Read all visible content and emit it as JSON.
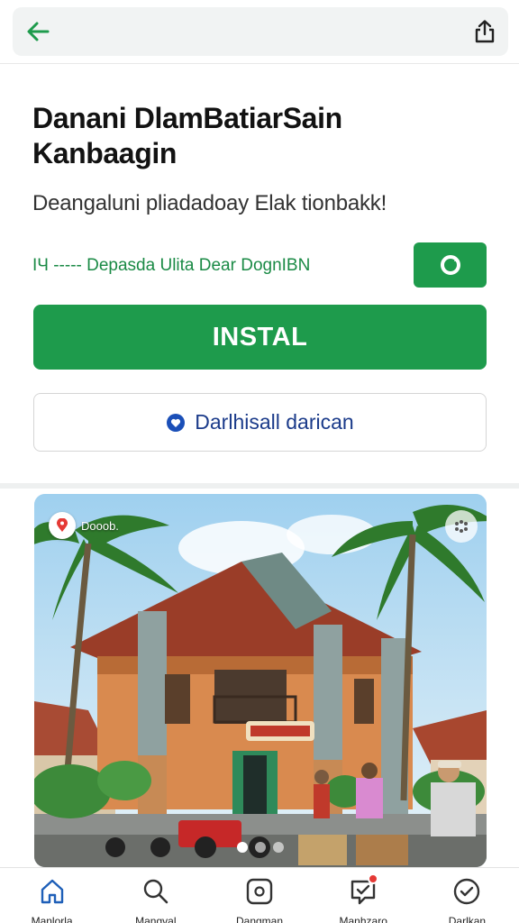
{
  "header": {
    "back_icon": "arrow-left-icon",
    "share_icon": "share-icon",
    "accent_color": "#1e9b4c"
  },
  "app": {
    "title": "Danani DlamBatiarSain Kanbaagin",
    "subtitle": "Deangaluni pliadadoay Elak tionbakk!"
  },
  "developer_link": {
    "text": "IЧ ----- Depasda Ulita Dear DognIBN",
    "badge_icon": "refresh-icon"
  },
  "install_button": {
    "label": "INSTAL"
  },
  "wishlist_button": {
    "label": "Darlhisall darican",
    "icon": "heart-icon"
  },
  "photo": {
    "location_label": "Dooob.",
    "location_icon": "map-pin-icon",
    "more_icon": "more-dots-icon",
    "active_index": 0,
    "page_count": 3
  },
  "bottom_nav": {
    "items": [
      {
        "label": "Manlorla",
        "icon": "home-icon",
        "active": true
      },
      {
        "label": "Mangval",
        "icon": "search-icon",
        "active": false
      },
      {
        "label": "Dangman",
        "icon": "apps-icon",
        "active": false
      },
      {
        "label": "Manhzaro",
        "icon": "updates-icon",
        "active": false,
        "badge": true
      },
      {
        "label": "Darlkan",
        "icon": "profile-icon",
        "active": false
      }
    ]
  }
}
